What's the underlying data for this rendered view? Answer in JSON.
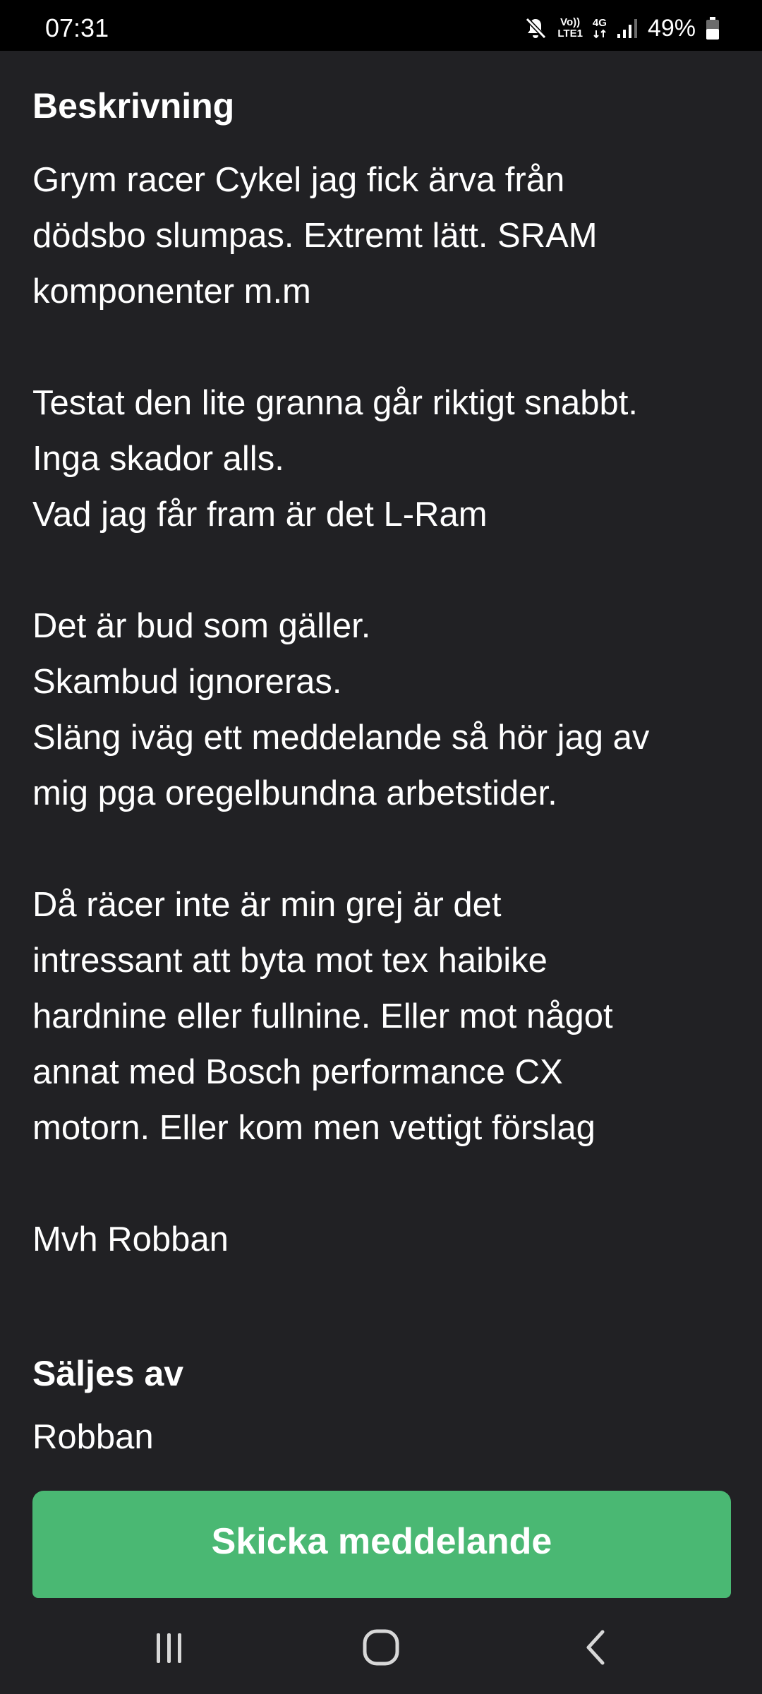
{
  "status_bar": {
    "time": "07:31",
    "net_top": "Vo))",
    "net_bottom": "LTE1",
    "net_type": "4G",
    "battery": "49%",
    "icons": [
      "mute-icon",
      "volte-icon",
      "4g-icon",
      "signal-icon",
      "battery-icon"
    ]
  },
  "description": {
    "heading": "Beskrivning",
    "text": "Grym racer Cykel jag fick ärva från\ndödsbo slumpas. Extremt lätt. SRAM\nkomponenter m.m\n\nTestat den lite granna går riktigt snabbt.\nInga skador alls.\nVad jag får fram är det L-Ram\n\nDet är bud som gäller.\nSkambud ignoreras.\nSläng iväg ett meddelande så hör jag av\nmig pga oregelbundna arbetstider.\n\nDå räcer inte är min grej är det\nintressant att byta mot tex haibike\nhardnine eller fullnine. Eller mot något\nannat med Bosch performance CX\nmotorn. Eller kom men vettigt förslag\n\nMvh Robban"
  },
  "seller": {
    "heading": "Säljes av",
    "name": "Robban"
  },
  "cta": {
    "label": "Skicka meddelande",
    "color": "#4ab873"
  },
  "nav_bar": {
    "icons": [
      "recent-apps-icon",
      "home-icon",
      "back-icon"
    ]
  },
  "colors": {
    "background": "#212124",
    "status_bar": "#000000",
    "text": "#ffffff"
  }
}
